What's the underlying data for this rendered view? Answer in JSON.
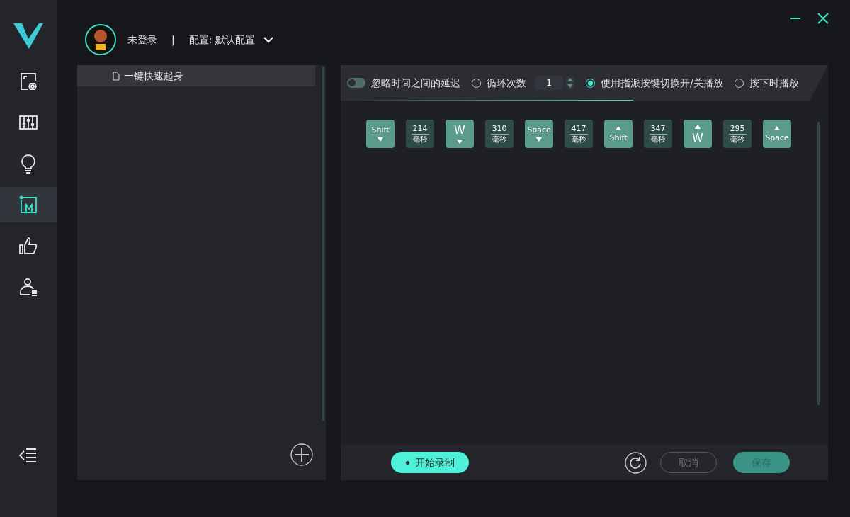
{
  "header": {
    "user": "未登录",
    "separator": "|",
    "profile": "配置: 默认配置"
  },
  "sidebar": {
    "items": [
      {
        "kind": "screen-settings",
        "selected": false
      },
      {
        "kind": "equalizer",
        "selected": false
      },
      {
        "kind": "bulb",
        "selected": false
      },
      {
        "kind": "macro",
        "selected": true
      },
      {
        "kind": "thumbs-up",
        "selected": false
      },
      {
        "kind": "user-list",
        "selected": false
      }
    ]
  },
  "macro_list": {
    "items": [
      {
        "name": "一键快速起身",
        "selected": true
      }
    ]
  },
  "options": [
    {
      "kind": "toggle",
      "label": "忽略时间之间的延迟",
      "on": false
    },
    {
      "kind": "radio",
      "label": "循环次数",
      "selected": false,
      "count": "1"
    },
    {
      "kind": "radio",
      "label": "使用指派按键切换开/关播放",
      "selected": true
    },
    {
      "kind": "radio",
      "label": "按下时播放",
      "selected": false
    }
  ],
  "sequence": [
    {
      "kind": "key",
      "label": "Shift",
      "released": false
    },
    {
      "kind": "delay",
      "value": "214",
      "unit": "毫秒"
    },
    {
      "kind": "key",
      "label": "W",
      "released": false
    },
    {
      "kind": "delay",
      "value": "310",
      "unit": "毫秒"
    },
    {
      "kind": "key",
      "label": "Space",
      "released": false
    },
    {
      "kind": "delay",
      "value": "417",
      "unit": "毫秒"
    },
    {
      "kind": "key",
      "label": "Shift",
      "released": true
    },
    {
      "kind": "delay",
      "value": "347",
      "unit": "毫秒"
    },
    {
      "kind": "key",
      "label": "W",
      "released": true
    },
    {
      "kind": "delay",
      "value": "295",
      "unit": "毫秒"
    },
    {
      "kind": "key",
      "label": "Space",
      "released": true
    }
  ],
  "footer": {
    "record": "开始录制",
    "cancel": {
      "label": "取消",
      "disabled": true
    },
    "save": {
      "label": "保存",
      "disabled": true
    }
  }
}
